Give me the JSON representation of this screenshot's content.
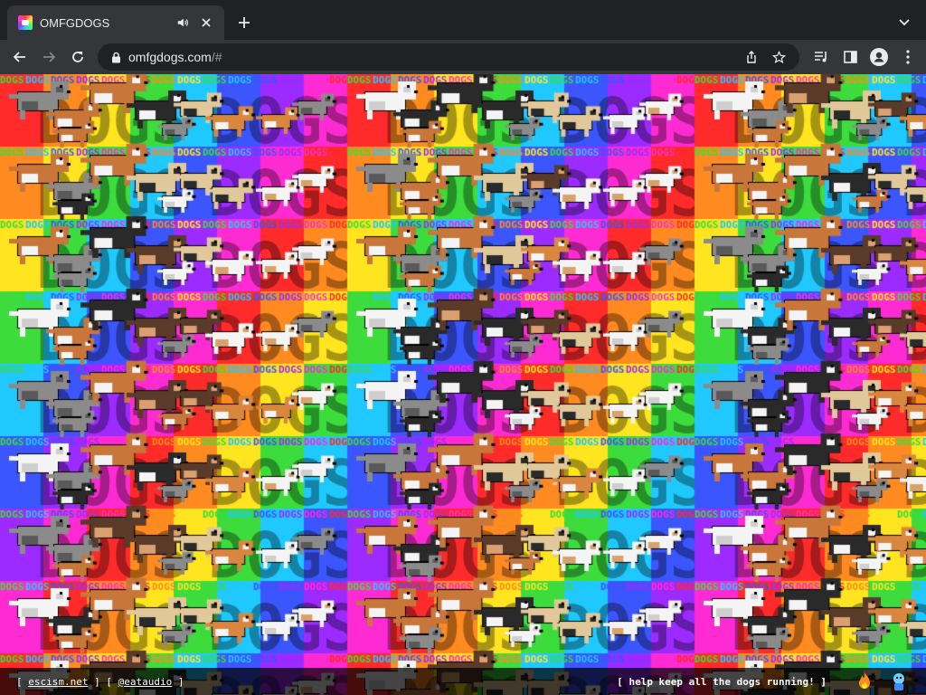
{
  "tab": {
    "title": "OMFGDOGS",
    "favicon": "omfgdogs-favicon-icon",
    "audio_icon": "speaker-icon",
    "close_icon": "close-icon"
  },
  "toolbar": {
    "url_host": "omfgdogs.com",
    "url_path": "/#",
    "icons": [
      "back-icon",
      "forward-icon",
      "reload-icon",
      "lock-icon",
      "share-icon",
      "star-icon",
      "media-control-icon",
      "side-panel-icon",
      "profile-icon",
      "menu-icon"
    ]
  },
  "page": {
    "background_colors": [
      "#ff2a2a",
      "#ff8a1f",
      "#ffe51f",
      "#3ddc3d",
      "#1fc9ff",
      "#3b55ff",
      "#9b2bff",
      "#ff2bd2"
    ],
    "watermark_text": "DOGS",
    "footer": {
      "bracket_open": "[",
      "bracket_close": "]",
      "link1": "escism.net",
      "link2": "@eataudio",
      "cta": "[ help keep all the dogs running! ]"
    }
  }
}
